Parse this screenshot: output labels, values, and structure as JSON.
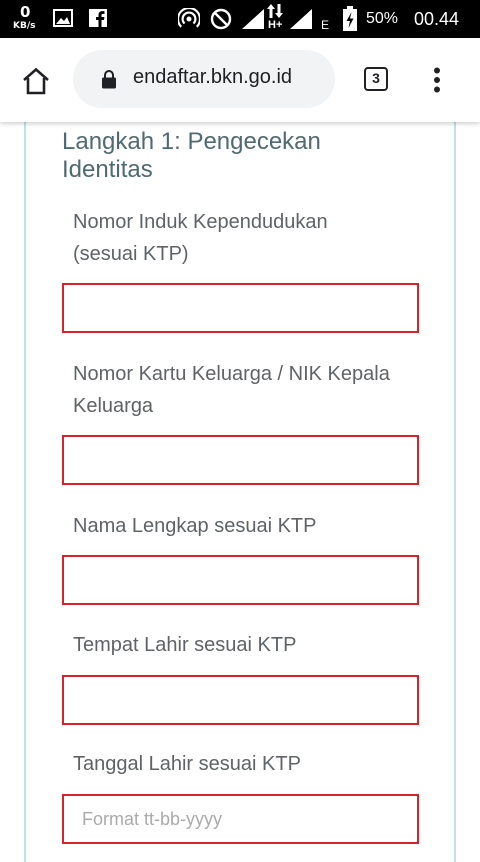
{
  "status_bar": {
    "net_speed_value": "0",
    "net_speed_unit": "KB/s",
    "battery_percent": "50%",
    "time": "00.44",
    "signal_label_1": "H+",
    "signal_label_2": "E",
    "icons": [
      "image-icon",
      "facebook-icon",
      "hotspot-icon",
      "do-not-disturb-icon",
      "signal-icon",
      "data-arrows-icon",
      "battery-icon"
    ]
  },
  "browser": {
    "url": "endaftar.bkn.go.id",
    "tab_count": "3",
    "icons": [
      "home-icon",
      "lock-icon",
      "more-vert-icon"
    ]
  },
  "form": {
    "step_title": "Langkah 1: Pengecekan Identitas",
    "fields": [
      {
        "label": "Nomor Induk Kependudukan (sesuai KTP)",
        "value": "",
        "placeholder": ""
      },
      {
        "label": "Nomor Kartu Keluarga / NIK Kepala Keluarga",
        "value": "",
        "placeholder": ""
      },
      {
        "label": "Nama Lengkap sesuai KTP",
        "value": "",
        "placeholder": ""
      },
      {
        "label": "Tempat Lahir sesuai KTP",
        "value": "",
        "placeholder": ""
      },
      {
        "label": "Tanggal Lahir sesuai KTP",
        "value": "",
        "placeholder": "Format tt-bb-yyyy"
      }
    ],
    "colors": {
      "error_border": "#d9222a",
      "panel_border": "#bfe3ea",
      "title": "#4f6a73"
    }
  }
}
